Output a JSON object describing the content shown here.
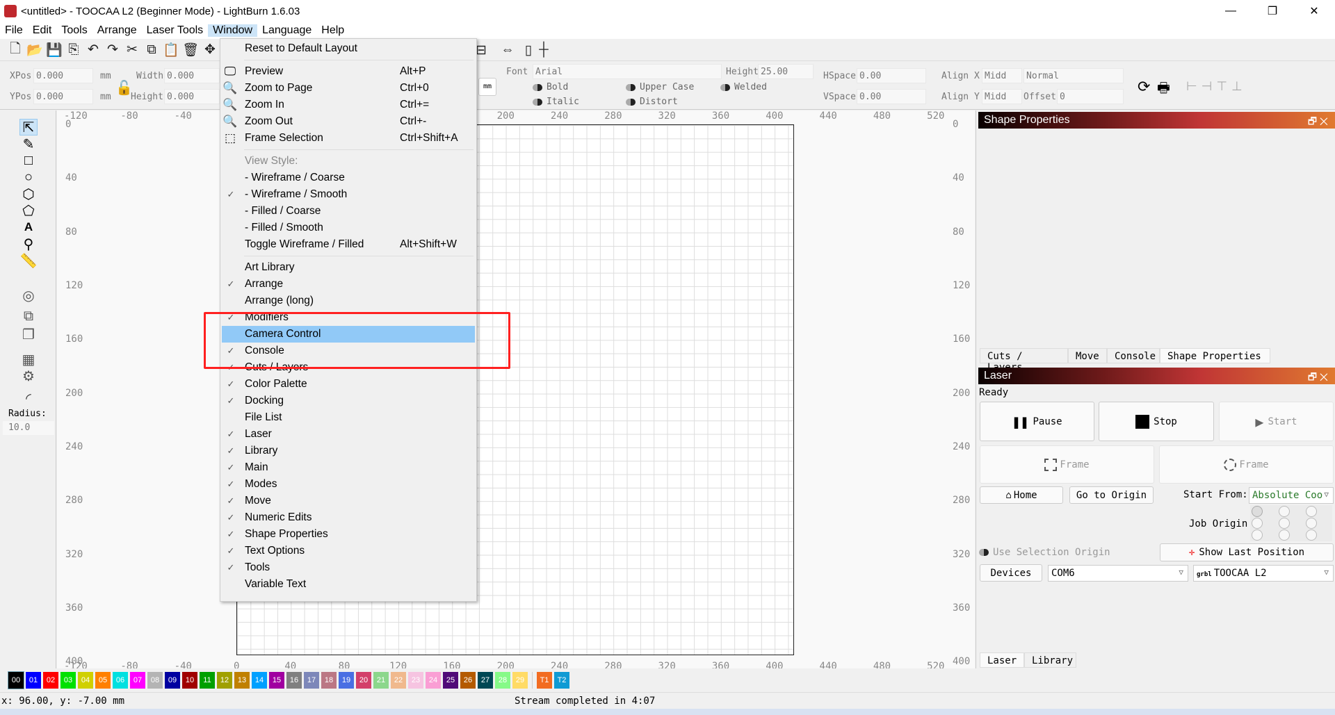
{
  "window": {
    "title": "<untitled> - TOOCAA L2 (Beginner Mode) - LightBurn 1.6.03",
    "minimize": "—",
    "restore": "❐",
    "close": "✕"
  },
  "menubar": [
    "File",
    "Edit",
    "Tools",
    "Arrange",
    "Laser Tools",
    "Window",
    "Language",
    "Help"
  ],
  "props": {
    "xpos_label": "XPos",
    "xpos": "0.000",
    "ypos_label": "YPos",
    "ypos": "0.000",
    "unit": "mm",
    "width_label": "Width",
    "width": "0.000",
    "height_label": "Height",
    "height": "0.000",
    "mm_button": "mm",
    "font_label": "Font",
    "font": "Arial",
    "text_height_label": "Height",
    "text_height": "25.00",
    "hspace_label": "HSpace",
    "hspace": "0.00",
    "vspace_label": "VSpace",
    "vspace": "0.00",
    "alignx_label": "Align X",
    "alignx": "Midd",
    "aligny_label": "Align Y",
    "aligny": "Midd",
    "mode": "Normal",
    "offset_label": "Offset",
    "offset": "0",
    "bold": "Bold",
    "italic": "Italic",
    "upper_case": "Upper Case",
    "distort": "Distort",
    "welded": "Welded"
  },
  "toolbox": {
    "radius_label": "Radius:",
    "radius": "10.0"
  },
  "rulers": {
    "top": [
      "-120",
      "-80",
      "-40",
      "0",
      "40",
      "80",
      "120",
      "160",
      "200",
      "240",
      "280",
      "320",
      "360",
      "400",
      "440",
      "480",
      "520"
    ],
    "left": [
      "0",
      "40",
      "80",
      "120",
      "160",
      "200",
      "240",
      "280",
      "320",
      "360",
      "400"
    ]
  },
  "menu": {
    "items": [
      {
        "label": "Reset to Default Layout"
      },
      {
        "sep": true
      },
      {
        "label": "Preview",
        "shortcut": "Alt+P",
        "icon": "monitor-icon"
      },
      {
        "label": "Zoom to Page",
        "shortcut": "Ctrl+0",
        "icon": "zoom-page-icon"
      },
      {
        "label": "Zoom In",
        "shortcut": "Ctrl+=",
        "icon": "zoom-in-icon"
      },
      {
        "label": "Zoom Out",
        "shortcut": "Ctrl+-",
        "icon": "zoom-out-icon"
      },
      {
        "label": "Frame Selection",
        "shortcut": "Ctrl+Shift+A",
        "icon": "frame-selection-icon"
      },
      {
        "sep": true
      },
      {
        "label": "View Style:",
        "disabled": true
      },
      {
        "label": "-  Wireframe / Coarse"
      },
      {
        "label": "-  Wireframe / Smooth",
        "checked": true
      },
      {
        "label": "-  Filled / Coarse"
      },
      {
        "label": "-  Filled / Smooth"
      },
      {
        "label": "Toggle Wireframe / Filled",
        "shortcut": "Alt+Shift+W"
      },
      {
        "sep": true
      },
      {
        "label": "Art Library"
      },
      {
        "label": "Arrange",
        "checked": true
      },
      {
        "label": "Arrange (long)"
      },
      {
        "label": "Modifiers",
        "checked": true
      },
      {
        "label": "Camera Control",
        "highlighted": true
      },
      {
        "label": "Console",
        "checked": true
      },
      {
        "label": "Cuts / Layers",
        "checked": true
      },
      {
        "label": "Color Palette",
        "checked": true
      },
      {
        "label": "Docking",
        "checked": true
      },
      {
        "label": "File List"
      },
      {
        "label": "Laser",
        "checked": true
      },
      {
        "label": "Library",
        "checked": true
      },
      {
        "label": "Main",
        "checked": true
      },
      {
        "label": "Modes",
        "checked": true
      },
      {
        "label": "Move",
        "checked": true
      },
      {
        "label": "Numeric Edits",
        "checked": true
      },
      {
        "label": "Shape Properties",
        "checked": true
      },
      {
        "label": "Text Options",
        "checked": true
      },
      {
        "label": "Tools",
        "checked": true
      },
      {
        "label": "Variable Text"
      }
    ]
  },
  "shape_panel": {
    "title": "Shape Properties",
    "tabs": [
      "Cuts / Layers",
      "Move",
      "Console",
      "Shape Properties"
    ],
    "active_tab": 3
  },
  "laser_panel": {
    "title": "Laser",
    "status": "Ready",
    "pause": "Pause",
    "stop": "Stop",
    "start": "Start",
    "frame1": "Frame",
    "frame2": "Frame",
    "home": "Home",
    "go_origin": "Go to Origin",
    "start_from_label": "Start From:",
    "start_from": "Absolute Coo",
    "job_origin_label": "Job Origin",
    "use_selection_origin": "Use Selection Origin",
    "show_last_position": "Show Last Position",
    "devices": "Devices",
    "port": "COM6",
    "device": "TOOCAA L2",
    "device_badge": "grbl",
    "tabs": [
      "Laser",
      "Library"
    ],
    "active_tab": 0
  },
  "palette": [
    {
      "label": "00",
      "color": "#000000"
    },
    {
      "label": "01",
      "color": "#0000ff"
    },
    {
      "label": "02",
      "color": "#ff0000"
    },
    {
      "label": "03",
      "color": "#00e000"
    },
    {
      "label": "04",
      "color": "#d0d000"
    },
    {
      "label": "05",
      "color": "#ff8000"
    },
    {
      "label": "06",
      "color": "#00e0e0"
    },
    {
      "label": "07",
      "color": "#ff00ff"
    },
    {
      "label": "08",
      "color": "#b4b4b4"
    },
    {
      "label": "09",
      "color": "#0000a0"
    },
    {
      "label": "10",
      "color": "#a00000"
    },
    {
      "label": "11",
      "color": "#00a000"
    },
    {
      "label": "12",
      "color": "#a0a000"
    },
    {
      "label": "13",
      "color": "#c08000"
    },
    {
      "label": "14",
      "color": "#00a0ff"
    },
    {
      "label": "15",
      "color": "#a000a0"
    },
    {
      "label": "16",
      "color": "#808080"
    },
    {
      "label": "17",
      "color": "#7d87b9"
    },
    {
      "label": "18",
      "color": "#bb7784"
    },
    {
      "label": "19",
      "color": "#4a6fe3"
    },
    {
      "label": "20",
      "color": "#d33f6a"
    },
    {
      "label": "21",
      "color": "#8cd78c"
    },
    {
      "label": "22",
      "color": "#f0b98d"
    },
    {
      "label": "23",
      "color": "#f6c4e1"
    },
    {
      "label": "24",
      "color": "#fa9ed4"
    },
    {
      "label": "25",
      "color": "#500a78"
    },
    {
      "label": "26",
      "color": "#b45a00"
    },
    {
      "label": "27",
      "color": "#004754"
    },
    {
      "label": "28",
      "color": "#86fa88"
    },
    {
      "label": "29",
      "color": "#ffdb66"
    },
    {
      "label": "T1",
      "color": "#f26c21"
    },
    {
      "label": "T2",
      "color": "#0f9ad4"
    }
  ],
  "status": {
    "coords": "x: 96.00, y: -7.00 mm",
    "stream": "Stream completed in 4:07"
  },
  "colors": {
    "highlight": "#91c9f7",
    "annotation": "#ff2020"
  }
}
